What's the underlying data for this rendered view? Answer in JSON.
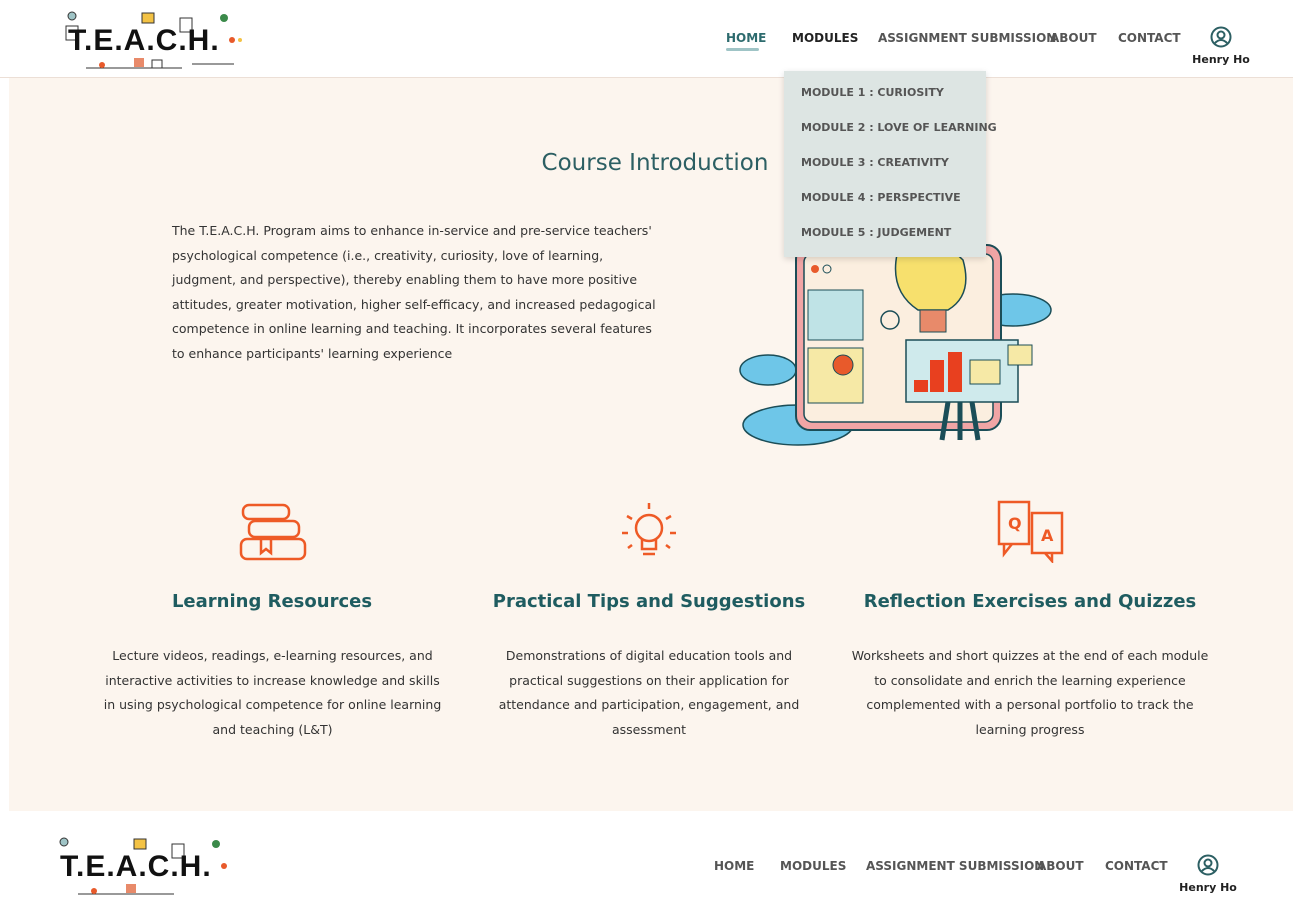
{
  "brand": {
    "logo_text": "T.E.A.C.H."
  },
  "nav": {
    "home": "HOME",
    "modules": "MODULES",
    "assignment": "ASSIGNMENT SUBMISSION",
    "about": "ABOUT",
    "contact": "CONTACT",
    "user_name": "Henry Ho"
  },
  "modules_menu": [
    "MODULE 1 : CURIOSITY",
    "MODULE 2 : LOVE OF LEARNING",
    "MODULE 3 : CREATIVITY",
    "MODULE 4 : PERSPECTIVE",
    "MODULE 5 : JUDGEMENT"
  ],
  "intro": {
    "title": "Course Introduction",
    "body": "The T.E.A.C.H. Program aims to enhance in-service and pre-service teachers' psychological competence (i.e., creativity, curiosity, love of learning, judgment, and perspective), thereby enabling them to have more positive attitudes, greater motivation, higher self-efficacy, and increased pedagogical competence in online learning and teaching. It incorporates several features to enhance participants' learning experience"
  },
  "features": [
    {
      "icon": "books-icon",
      "title": "Learning Resources",
      "desc": "Lecture videos, readings, e-learning resources, and interactive activities to increase knowledge and skills in using psychological competence for online learning and teaching (L&T)"
    },
    {
      "icon": "lightbulb-icon",
      "title": "Practical Tips and Suggestions",
      "desc": "Demonstrations of digital education tools and practical suggestions on their application for attendance and participation, engagement, and assessment"
    },
    {
      "icon": "qa-icon",
      "title": "Reflection Exercises and Quizzes",
      "desc": "Worksheets and short quizzes at the end of each module to consolidate and enrich the learning experience complemented with a personal portfolio to track the learning progress"
    }
  ],
  "colors": {
    "accent": "#2c5f63",
    "icon_orange": "#ee5a26",
    "page_bg": "#fcf5ee",
    "dropdown_bg": "#dde5e3"
  }
}
